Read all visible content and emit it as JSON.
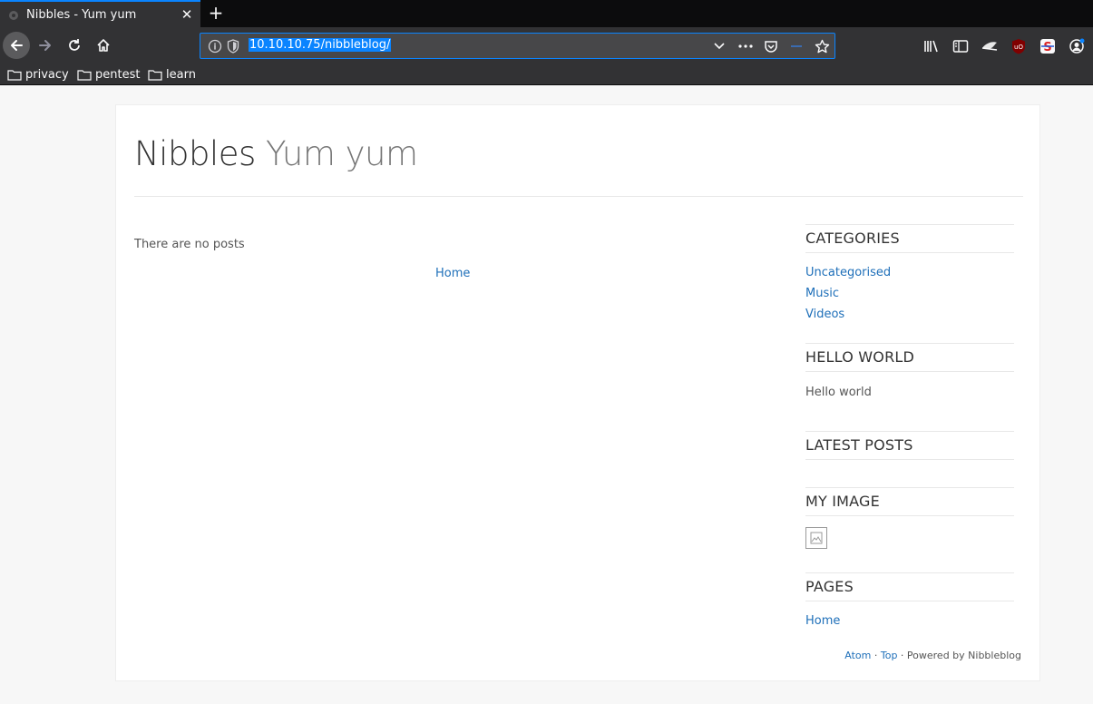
{
  "browser": {
    "tab_title": "Nibbles - Yum yum",
    "url_host": "10.10.10.75",
    "url_path": "/nibbleblog/",
    "bookmarks": [
      "privacy",
      "pentest",
      "learn"
    ]
  },
  "blog": {
    "name": "Nibbles",
    "slogan": "Yum yum",
    "no_posts": "There are no posts",
    "pager_home": "Home"
  },
  "sidebar": {
    "categories_title": "CATEGORIES",
    "categories": [
      "Uncategorised",
      "Music",
      "Videos"
    ],
    "hello_title": "HELLO WORLD",
    "hello_text": "Hello world",
    "latest_title": "LATEST POSTS",
    "image_title": "MY IMAGE",
    "pages_title": "PAGES",
    "pages": [
      "Home"
    ]
  },
  "footer": {
    "atom": "Atom",
    "sep1": " · ",
    "top": "Top",
    "powered": " · Powered by Nibbleblog"
  },
  "colors": {
    "link": "#1e6fb9",
    "chrome_dark": "#323234",
    "accent": "#0a84ff"
  }
}
